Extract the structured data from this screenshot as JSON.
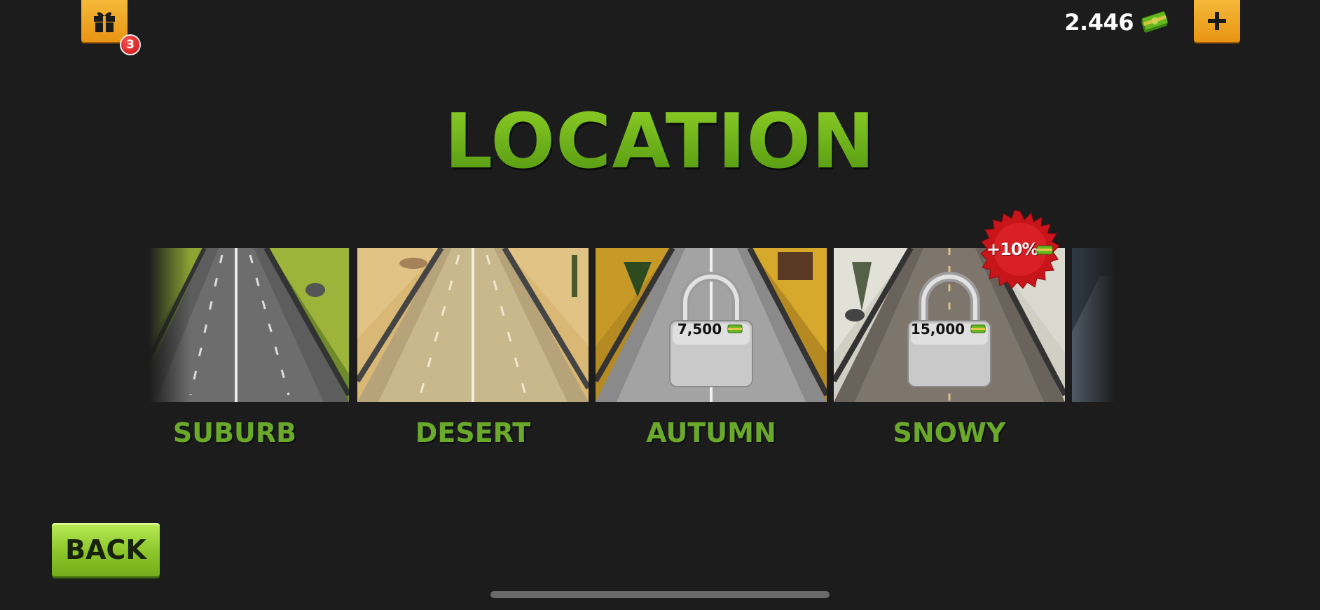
{
  "header": {
    "gift_badge_count": "3",
    "currency_amount": "2.446",
    "currency_icon": "cash-icon",
    "add_icon": "plus-icon",
    "gift_icon": "gift-icon"
  },
  "title": "LOCATION",
  "locations": [
    {
      "name": "SUBURB",
      "locked": false,
      "theme": "grass"
    },
    {
      "name": "DESERT",
      "locked": false,
      "theme": "sand"
    },
    {
      "name": "AUTUMN",
      "locked": true,
      "price": "7,500",
      "theme": "autumn"
    },
    {
      "name": "SNOWY",
      "locked": true,
      "price": "15,000",
      "theme": "snow",
      "bonus": "+10%"
    }
  ],
  "back_label": "BACK",
  "colors": {
    "accent_green": "#6bb51a",
    "button_orange": "#f0a526",
    "badge_red": "#d81818"
  }
}
